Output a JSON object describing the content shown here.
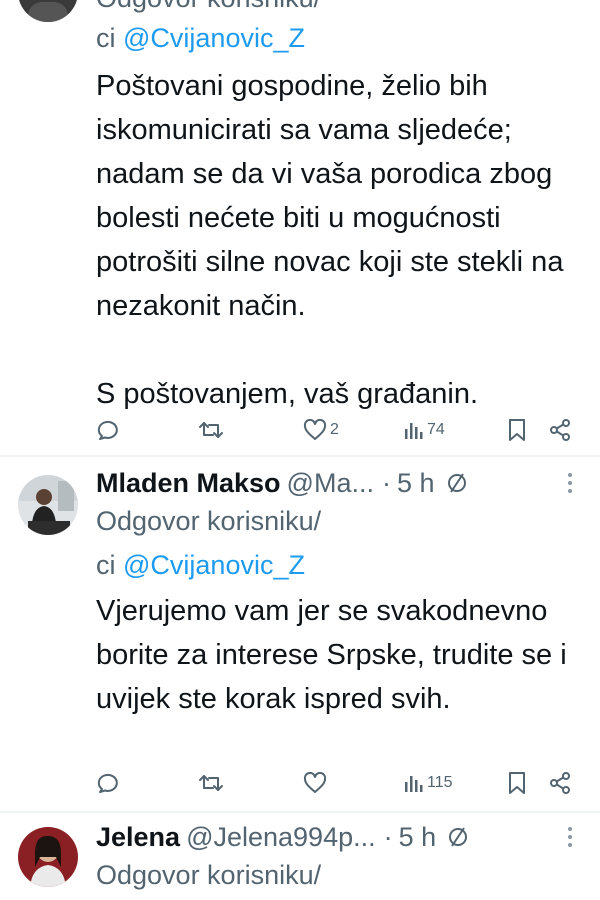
{
  "tweet1": {
    "top_text_partial": "Odgovor korisniku/",
    "reply_prefix": "ci",
    "reply_mention": "@Cvijanovic_Z",
    "paragraph1": "Poštovani gospodine, želio bih iskomunicirati sa vama sljedeće; nadam se da vi vaša porodica zbog bolesti nećete biti u mogućnosti potrošiti silne novac koji ste stekli na nezakonit način.",
    "paragraph2": "S poštovanjem, vaš građanin.",
    "likes": "2",
    "views": "74"
  },
  "tweet2": {
    "name": "Mladen Makso",
    "handle": "@Ma...",
    "dot": "·",
    "time": "5 h",
    "reply_to_label": "Odgovor korisniku/",
    "reply_prefix": "ci",
    "reply_mention": "@Cvijanovic_Z",
    "text": "Vjerujemo vam jer se svakodnevno borite za interese Srpske, trudite se i uvijek ste korak ispred svih.",
    "views": "115"
  },
  "tweet3": {
    "name": "Jelena",
    "handle": "@Jelena994p...",
    "dot": "·",
    "time": "5 h",
    "reply_to_label": "Odgovor korisniku/"
  },
  "icons": {
    "reply": "reply-icon",
    "retweet": "retweet-icon",
    "like": "heart-icon",
    "views": "views-icon",
    "bookmark": "bookmark-icon",
    "share": "share-icon",
    "more": "more-icon",
    "noreply": "no-reply-icon"
  },
  "colors": {
    "mention": "#1d9bf0",
    "secondary": "#536471",
    "text": "#0f1419",
    "divider": "#eff3f4"
  }
}
